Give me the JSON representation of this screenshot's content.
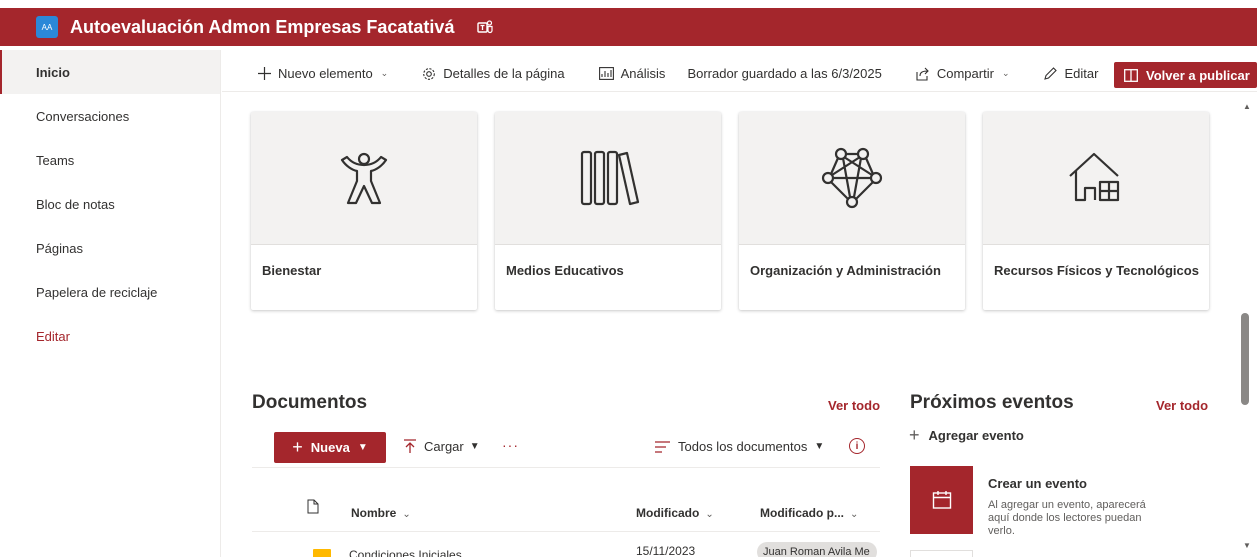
{
  "site": {
    "logo_text": "AA",
    "title": "Autoevaluación Admon Empresas Facatativá"
  },
  "nav": {
    "items": [
      {
        "label": "Inicio"
      },
      {
        "label": "Conversaciones"
      },
      {
        "label": "Teams"
      },
      {
        "label": "Bloc de notas"
      },
      {
        "label": "Páginas"
      },
      {
        "label": "Papelera de reciclaje"
      },
      {
        "label": "Editar"
      }
    ]
  },
  "command_bar": {
    "new_item": "Nuevo elemento",
    "page_details": "Detalles de la página",
    "analytics": "Análisis",
    "draft_status": "Borrador guardado a las 6/3/2025",
    "share": "Compartir",
    "edit": "Editar",
    "republish": "Volver a publicar"
  },
  "quick_links": [
    {
      "label": "Bienestar",
      "icon": "person-icon"
    },
    {
      "label": "Medios Educativos",
      "icon": "library-icon"
    },
    {
      "label": "Organización y Administración",
      "icon": "network-icon"
    },
    {
      "label": "Recursos Físicos y Tecnológicos",
      "icon": "building-icon"
    }
  ],
  "documents": {
    "title": "Documentos",
    "see_all": "Ver todo",
    "new_label": "Nueva",
    "upload_label": "Cargar",
    "more": "···",
    "view_label": "Todos los documentos",
    "info_symbol": "i",
    "columns": {
      "name": "Nombre",
      "modified": "Modificado",
      "modified_by": "Modificado p..."
    },
    "rows": [
      {
        "name": "Condiciones Iniciales",
        "modified": "15/11/2023",
        "modified_by": "Juan Roman Avila Me"
      }
    ]
  },
  "events": {
    "title": "Próximos eventos",
    "see_all": "Ver todo",
    "add_event": "Agregar evento",
    "card_title": "Crear un evento",
    "card_desc": "Al agregar un evento, aparecerá aquí donde los lectores puedan verlo."
  },
  "colors": {
    "brand": "#a4262c",
    "site_logo": "#2b88d8",
    "tile_bg": "#f3f2f1",
    "folder": "#ffb900"
  }
}
